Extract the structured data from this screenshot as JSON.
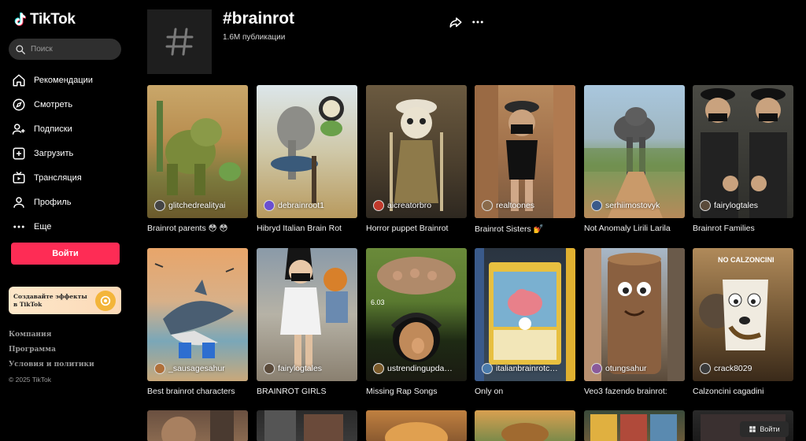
{
  "brand": {
    "name": "TikTok"
  },
  "search": {
    "placeholder": "Поиск"
  },
  "nav": [
    {
      "label": "Рекомендации",
      "icon": "home-icon"
    },
    {
      "label": "Смотреть",
      "icon": "compass-icon"
    },
    {
      "label": "Подписки",
      "icon": "user-plus-icon"
    },
    {
      "label": "Загрузить",
      "icon": "upload-icon"
    },
    {
      "label": "Трансляция",
      "icon": "live-icon"
    },
    {
      "label": "Профиль",
      "icon": "profile-icon"
    },
    {
      "label": "Еще",
      "icon": "more-icon"
    }
  ],
  "login": {
    "label": "Войти"
  },
  "effects": {
    "text": "Создавайте эффекты в TikTok"
  },
  "footer": {
    "links": [
      "Компания",
      "Программа",
      "Условия и политики"
    ],
    "copyright": "© 2025 TikTok"
  },
  "hashtag": {
    "title": "#brainrot",
    "count": "1.6M публикации"
  },
  "videos": [
    {
      "author": "glitchedrealityai",
      "caption": "Brainrot parents 😳 😳"
    },
    {
      "author": "debrainroot1",
      "caption": "Hibryd Italian Brain Rot"
    },
    {
      "author": "aicreatorbro",
      "caption": "Horror puppet Brainrot"
    },
    {
      "author": "realtoones",
      "caption": "Brainrot Sisters 💅"
    },
    {
      "author": "serhiimostovyk",
      "caption": "Not Anomaly Lirili Larila"
    },
    {
      "author": "fairylogtales",
      "caption": "Brainrot Families"
    },
    {
      "author": "_sausagesahur",
      "caption": "Best brainrot characters"
    },
    {
      "author": "fairylogtales",
      "caption": "BRAINROT GIRLS"
    },
    {
      "author": "ustrendingupda…",
      "caption": "Missing Rap Songs"
    },
    {
      "author": "italianbrainrotc…",
      "caption": "Only on"
    },
    {
      "author": "otungsahur",
      "caption": "Veo3 fazendo brainrot:"
    },
    {
      "author": "crack8029",
      "caption": "Calzoncini cagadini"
    }
  ],
  "floating_login": {
    "label": "Войти"
  }
}
